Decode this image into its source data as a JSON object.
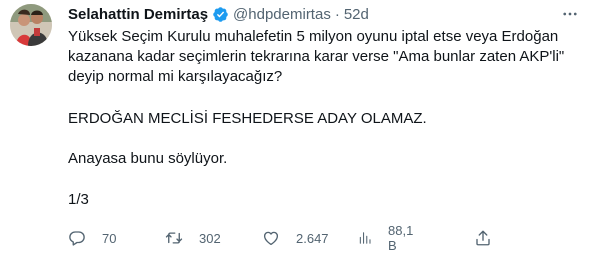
{
  "tweet": {
    "author_name": "Selahattin Demirtaş",
    "author_handle": "@hdpdemirtas",
    "separator": "·",
    "time": "52d",
    "paragraphs": [
      "Yüksek Seçim Kurulu muhalefetin 5 milyon oyunu iptal etse veya Erdoğan kazanana kadar seçimlerin tekrarına karar verse \"Ama bunlar zaten AKP'li\" deyip normal mi karşılayacağız?",
      "ERDOĞAN MECLİSİ FESHEDERSE ADAY OLAMAZ.",
      "Anayasa bunu söylüyor.",
      "1/3"
    ]
  },
  "actions": {
    "reply_count": "70",
    "retweet_count": "302",
    "like_count": "2.647",
    "view_count": "88,1 B"
  },
  "icons": {
    "verified": "verified-badge-icon",
    "more": "more-options-icon",
    "reply": "reply-icon",
    "retweet": "retweet-icon",
    "like": "heart-icon",
    "views": "views-chart-icon",
    "share": "share-icon"
  },
  "colors": {
    "verified": "#1d9bf0",
    "secondary_text": "#536471",
    "text": "#0f1419"
  }
}
